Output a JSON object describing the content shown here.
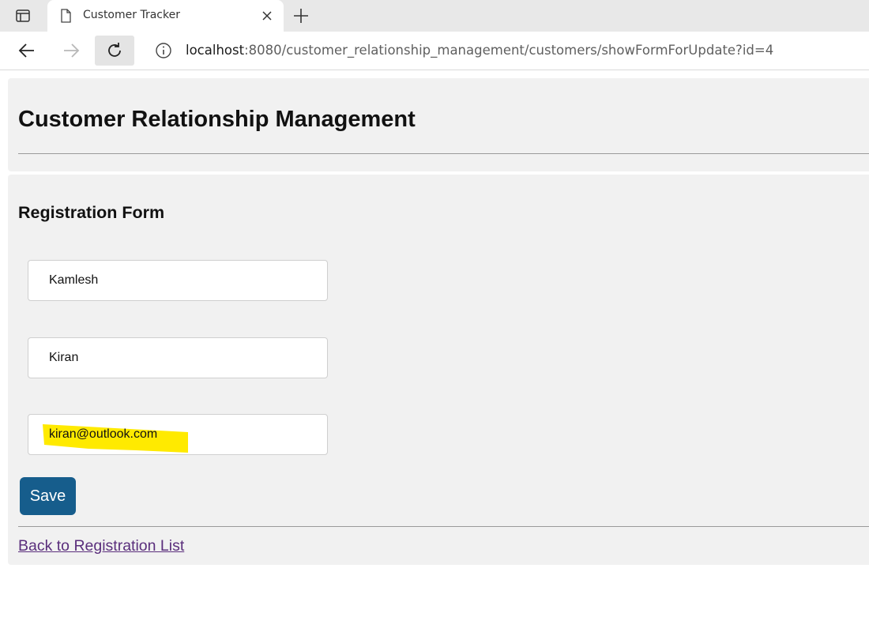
{
  "browser": {
    "tab_title": "Customer Tracker",
    "address": {
      "host": "localhost",
      "path": ":8080/customer_relationship_management/customers/showFormForUpdate?id=4"
    },
    "icons": [
      "sidebar-icon",
      "page-icon",
      "close-icon",
      "plus-icon",
      "back-arrow-icon",
      "forward-arrow-icon",
      "reload-icon",
      "info-icon"
    ]
  },
  "page": {
    "title": "Customer Relationship Management",
    "form_title": "Registration Form",
    "fields": {
      "first_name": "Kamlesh",
      "last_name": "Kiran",
      "email": "kiran@outlook.com"
    },
    "save_label": "Save",
    "back_link": "Back to Registration List"
  },
  "colors": {
    "panel_bg": "#f1f1f1",
    "save_button": "#165d8c",
    "highlight": "#ffea00",
    "visited_link": "#5a2e7c"
  }
}
